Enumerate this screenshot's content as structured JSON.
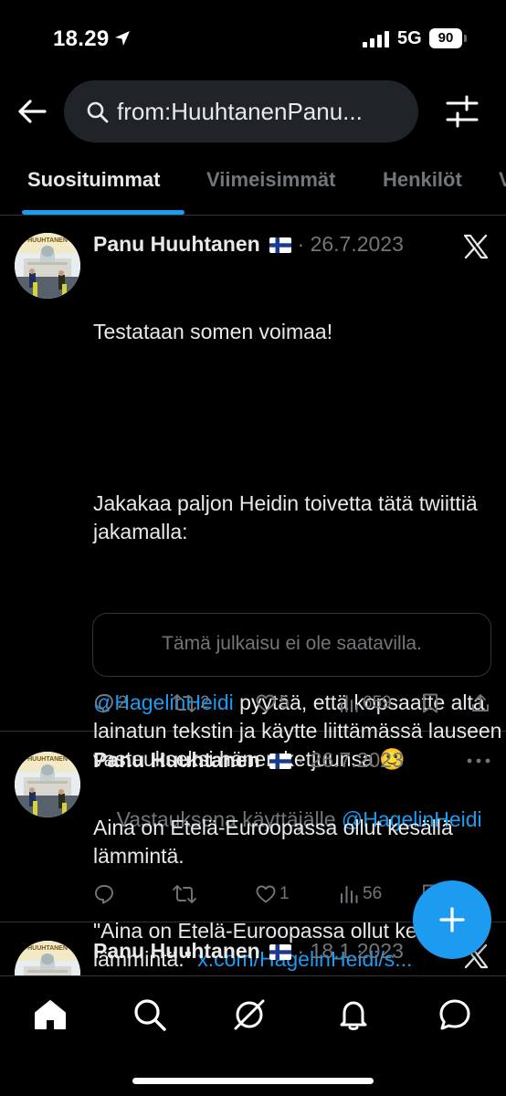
{
  "status_bar": {
    "time": "18.29",
    "network": "5G",
    "battery": "90"
  },
  "header": {
    "search_query": "from:HuuhtanenPanu..."
  },
  "tabs": [
    {
      "label": "Suosituimmat",
      "active": true
    },
    {
      "label": "Viimeisimmät",
      "active": false
    },
    {
      "label": "Henkilöt",
      "active": false
    },
    {
      "label": "V",
      "active": false
    }
  ],
  "avatar_badge_text": "HUUHTANEN",
  "tweets": [
    {
      "name": "Panu Huuhtanen",
      "date": "· 26.7.2023",
      "para1": "Testataan somen voimaa!",
      "para2": "Jakakaa paljon Heidin toivetta tätä twiittiä jakamalla:",
      "mention": "@HagelinHeidi",
      "para3_rest": " pyytää, että kopsaatte alta lainatun tekstin ja käytte liittämässä lauseen vastaukseksi hänen ketjuunsa 🙂",
      "quote_text": "\"Aina on Etelä-Euroopassa ollut kesällä lämmintä.\" ",
      "quote_link": "x.com/HagelinHeidi/s...",
      "unavailable": "Tämä julkaisu ei ole saatavilla.",
      "replies": "2",
      "reposts": "2",
      "likes": "5",
      "views": "659"
    },
    {
      "name": "Panu Huuhtanen",
      "date": "· 26.7.2023",
      "reply_prefix": "Vastauksena käyttäjälle ",
      "reply_to": "@HagelinHeidi",
      "text": "Aina on Etelä-Euroopassa ollut kesällä lämmintä.",
      "replies": "",
      "reposts": "",
      "likes": "1",
      "views": "56"
    },
    {
      "name": "Panu Huuhtanen",
      "date": "· 18.1.2023"
    }
  ],
  "colors": {
    "accent": "#1d9bf0",
    "muted": "#71767b",
    "divider": "#2f3336",
    "background": "#000000"
  }
}
